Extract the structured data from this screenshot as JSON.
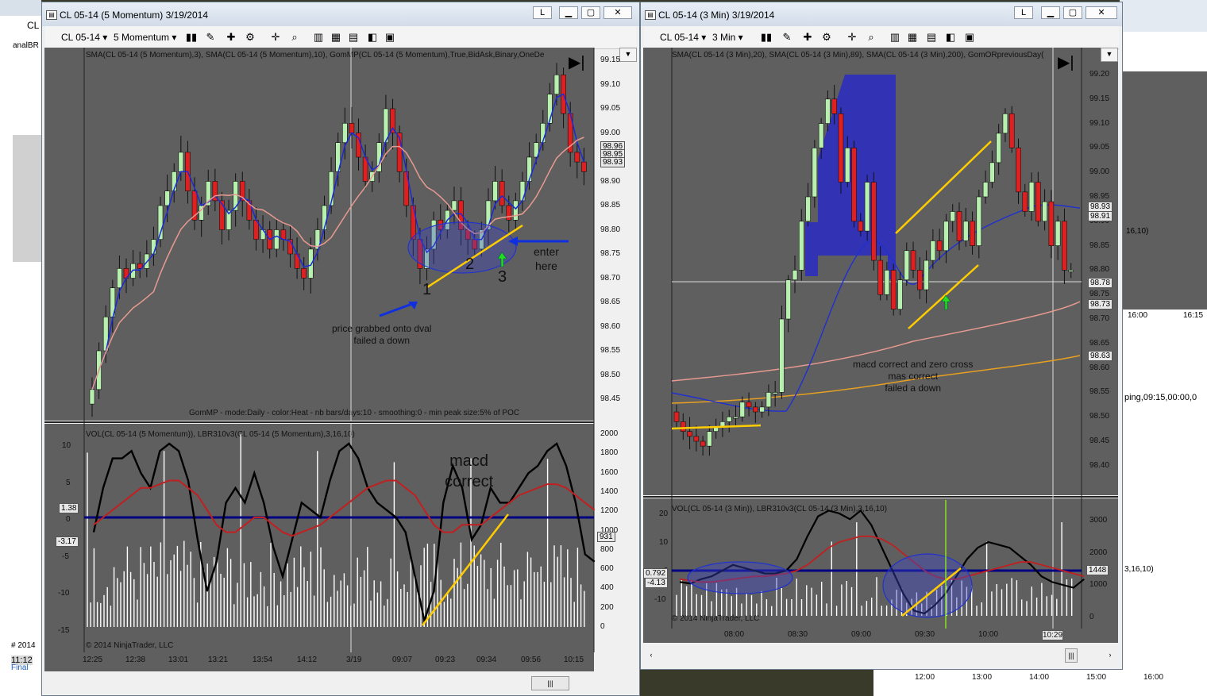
{
  "window1": {
    "title": "CL 05-14 (5 Momentum)  3/19/2014",
    "instrument": "CL 05-14",
    "period": "5 Momentum",
    "price_header": "SMA(CL 05-14 (5 Momentum),3), SMA(CL 05-14 (5 Momentum),10), GomMP(CL 05-14 (5 Momentum),True,BidAsk,Binary,OneDe",
    "gommp_text": "GomMP - mode:Daily  - color:Heat - nb bars/days:10 - smoothing:0 - min peak size:5% of POC",
    "lower_header": "VOL(CL 05-14 (5 Momentum)), LBR310v3(CL 05-14 (5 Momentum),3,16,10)",
    "copyright": "© 2014 NinjaTrader, LLC",
    "price_ticks": [
      "99.15",
      "99.10",
      "99.05",
      "99.00",
      "98.95",
      "98.90",
      "98.85",
      "98.80",
      "98.75",
      "98.70",
      "98.65",
      "98.60",
      "98.55",
      "98.50",
      "98.45"
    ],
    "price_tags": [
      "98.96",
      "98.95",
      "98.93"
    ],
    "osc_ticks": [
      "10",
      "5",
      "0",
      "-5",
      "-10",
      "-15"
    ],
    "osc_tags": [
      "1.38",
      "-3.17"
    ],
    "vol_ticks": [
      "2000",
      "1800",
      "1600",
      "1400",
      "1200",
      "1000",
      "800",
      "600",
      "400",
      "200",
      "0"
    ],
    "vol_tag": "931",
    "time_ticks": [
      "12:25",
      "12:38",
      "13:01",
      "13:21",
      "13:54",
      "14:12",
      "3/19",
      "09:07",
      "09:23",
      "09:34",
      "09:56",
      "10:15"
    ],
    "annotations": {
      "n1": "1",
      "n2": "2",
      "n3": "3",
      "enter": "enter\nhere",
      "price_grabbed": "price grabbed onto dval\nfailed a down",
      "macd": "macd\ncorrect"
    }
  },
  "window2": {
    "title": "CL 05-14 (3 Min)  3/19/2014",
    "instrument": "CL 05-14",
    "period": "3 Min",
    "price_header": "SMA(CL 05-14 (3 Min),20), SMA(CL 05-14 (3 Min),89), SMA(CL 05-14 (3 Min),200), GomORpreviousDay(",
    "lower_header": "VOL(CL 05-14 (3 Min)), LBR310v3(CL 05-14 (3 Min),3,16,10)",
    "copyright": "© 2014 NinjaTrader, LLC",
    "price_ticks": [
      "99.20",
      "99.15",
      "99.10",
      "99.05",
      "99.00",
      "98.95",
      "98.90",
      "98.85",
      "98.80",
      "98.75",
      "98.70",
      "98.65",
      "98.60",
      "98.55",
      "98.50",
      "98.45",
      "98.40"
    ],
    "price_tags": [
      "98.93",
      "98.91",
      "98.78",
      "98.73",
      "98.63"
    ],
    "osc_ticks": [
      "20",
      "10",
      "0",
      "-10"
    ],
    "osc_tags": [
      "0.792",
      "-4.13"
    ],
    "vol_ticks": [
      "3000",
      "2000",
      "1000",
      "0"
    ],
    "vol_tag": "1448",
    "time_ticks": [
      "08:00",
      "08:30",
      "09:00",
      "09:30",
      "10:00",
      "10:29"
    ],
    "annotation": "macd correct and zero cross\nmas correct\nfailed a down"
  },
  "background": {
    "left_window_title": "CL",
    "left_label": "analBR",
    "left_time": "11:12",
    "left_year": "# 2014",
    "left_final": "Final",
    "right_label_a": "16,10)",
    "right_label_b": "ping,09:15,00:00,0",
    "right_label_c": "3,16,10)",
    "right_times_a": [
      "16:00",
      "16:15"
    ],
    "bottom_times": [
      "12:00",
      "13:00",
      "14:00",
      "15:00",
      "16:00"
    ]
  },
  "colors": {
    "plot_bg": "#5f5f5f",
    "up_candle": "#b8f0b0",
    "down_candle": "#e02020",
    "annotation_yellow": "#ffcc00",
    "zero_line": "#000080",
    "or_band": "#3333cc"
  }
}
